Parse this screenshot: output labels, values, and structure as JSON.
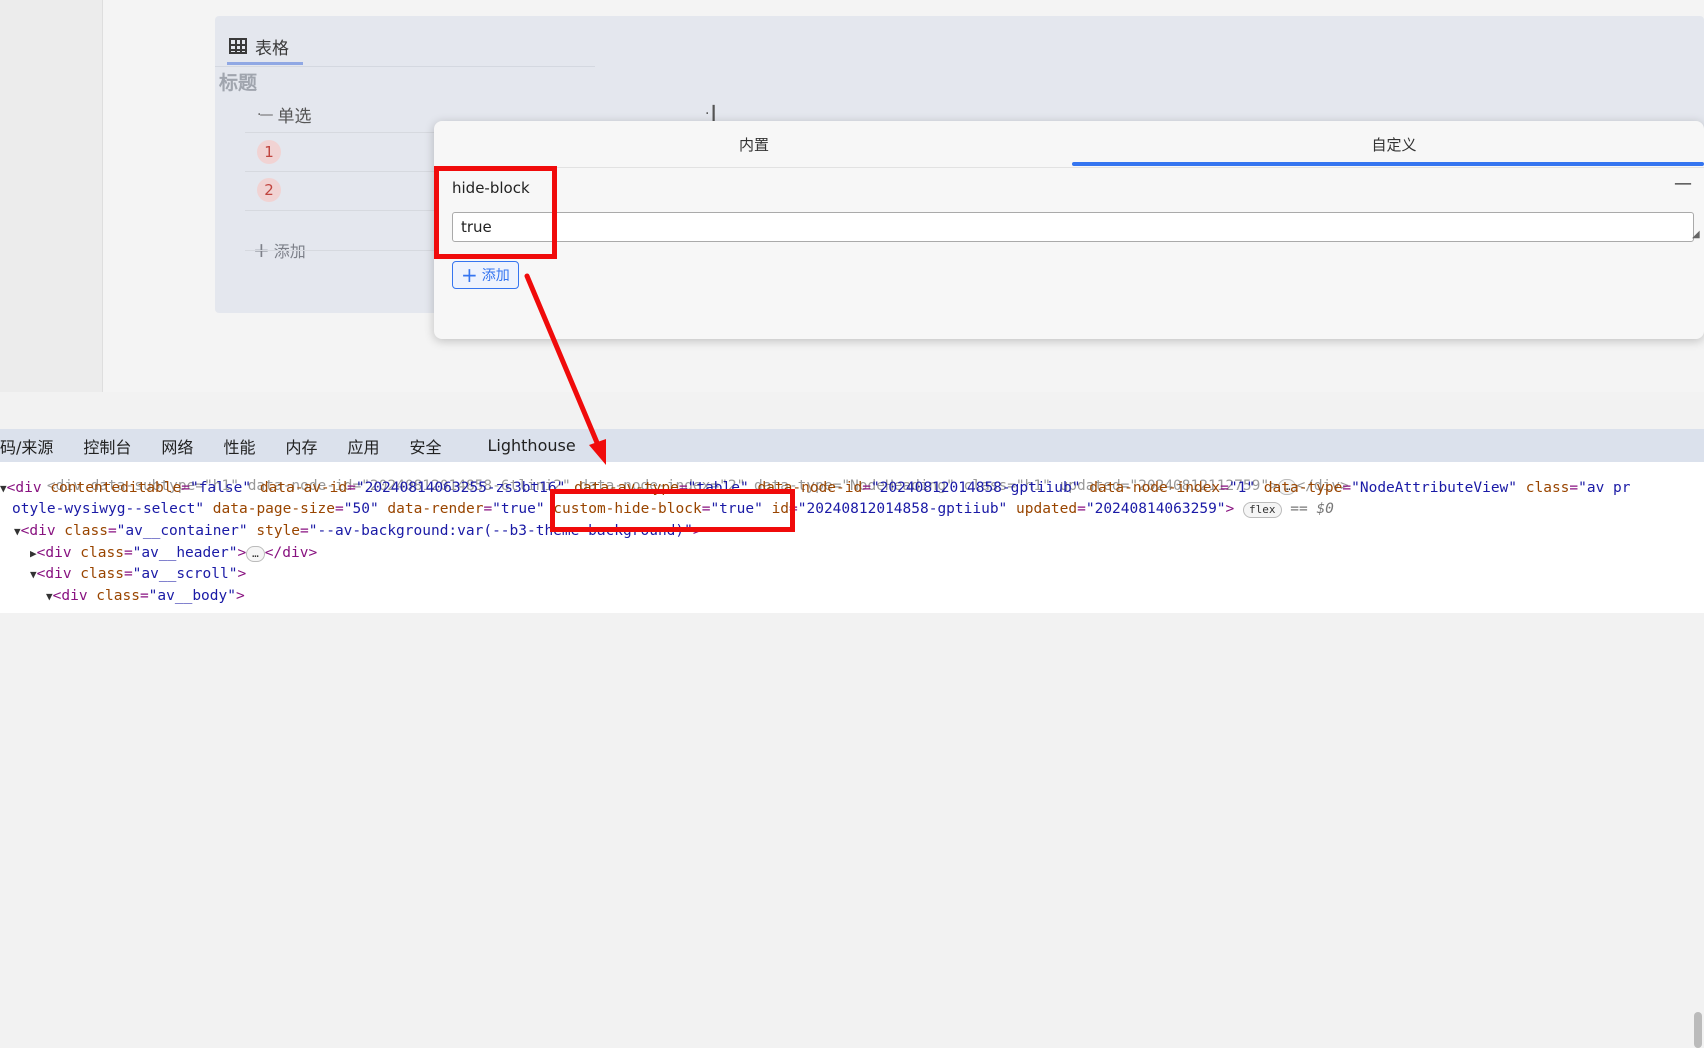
{
  "editor": {
    "tab_label": "表格",
    "title": "标题",
    "column_label": "单选",
    "rows": [
      "1",
      "2"
    ],
    "add_label": "添加"
  },
  "dialog": {
    "tabs": [
      {
        "label": "内置"
      },
      {
        "label": "自定义"
      }
    ],
    "attr_name": "hide-block",
    "attr_value": "true",
    "add_label": "添加"
  },
  "devtools": {
    "tabs": [
      "码/来源",
      "控制台",
      "网络",
      "性能",
      "内存",
      "应用",
      "安全",
      "Lighthouse"
    ],
    "line0": "<div data-subtype=\"h1\" data-node-id=\"20240812014858-6tlini2\" data-node-index=\"2\" data-type=\"NodeHeading\" class=\"h1\" updated=\"20240812112759\">",
    "line0_end": "</div>",
    "line1": {
      "tag": "<div",
      "attrs": [
        {
          "n": "contenteditable",
          "v": "\"false\""
        },
        {
          "n": "data-av-id",
          "v": "\"20240814063255-zs3bt16\""
        },
        {
          "n": "data-av-type",
          "v": "\"table\""
        },
        {
          "n": "data-node-id",
          "v": "\"20240812014858-gptiiub\""
        },
        {
          "n": "data-node-index",
          "v": "\"1\""
        },
        {
          "n": "data-type",
          "v": "\"NodeAttributeView\""
        },
        {
          "n": "class",
          "v": "\"av pr"
        }
      ]
    },
    "line2": {
      "prefix": "otyle-wysiwyg--select\"",
      "attrs": [
        {
          "n": "data-page-size",
          "v": "\"50\""
        },
        {
          "n": "data-render",
          "v": "\"true\""
        },
        {
          "n": "custom-hide-block",
          "v": "\"true\""
        },
        {
          "n": "id",
          "v": "\"20240812014858-gptiiub\""
        },
        {
          "n": "updated",
          "v": "\"20240814063259\""
        }
      ],
      "pill": "flex",
      "eq": "== $0"
    },
    "line3": {
      "tag": "<div",
      "n": "class",
      "v": "\"av__container\"",
      "n2": "style",
      "v2": "\"--av-background:var(--b3-theme-background)\"",
      "close": ">"
    },
    "line4": {
      "tag": "<div",
      "n": "class",
      "v": "\"av__header\"",
      "close": "</div>"
    },
    "line5": {
      "tag": "<div",
      "n": "class",
      "v": "\"av__scroll\"",
      "close": ">"
    },
    "line6": {
      "tag": "<div",
      "n": "class",
      "v": "\"av__body\"",
      "close": ">"
    }
  }
}
